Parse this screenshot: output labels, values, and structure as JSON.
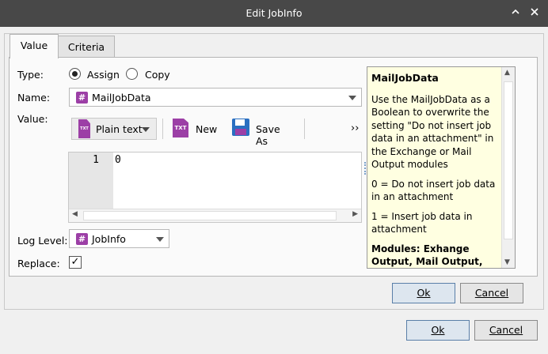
{
  "window": {
    "title": "Edit JobInfo",
    "expand_icon": "expand-icon",
    "close_icon": "close-icon"
  },
  "tabs": [
    {
      "label": "Value"
    },
    {
      "label": "Criteria"
    }
  ],
  "form": {
    "type_label": "Type:",
    "type_options": [
      {
        "label": "Assign",
        "selected": true
      },
      {
        "label": "Copy",
        "selected": false
      }
    ],
    "name_label": "Name:",
    "name_value": "MailJobData",
    "value_label": "Value:",
    "log_level_label": "Log Level:",
    "log_level_value": "JobInfo",
    "replace_label": "Replace:",
    "replace_checked": true,
    "replace_check_glyph": "✓"
  },
  "toolbar": {
    "format_label": "Plain text",
    "new_label": "New",
    "save_as_label": "Save As",
    "more_label": "››",
    "txt_icon_text": "TXT"
  },
  "editor": {
    "line_number": "1",
    "content": "0"
  },
  "help": {
    "title": "MailJobData",
    "paragraphs": [
      "Use the MailJobData as a Boolean to overwrite the setting \"Do not insert job data in an attachment\" in the Exchange or Mail Output modules",
      "0 = Do not insert job data in an attachment",
      "1 = Insert job data in attachment"
    ],
    "footer": "Modules: Exhange Output, Mail Output,"
  },
  "inner_buttons": {
    "ok": "Ok",
    "cancel": "Cancel"
  },
  "outer_buttons": {
    "ok": "Ok",
    "cancel": "Cancel"
  },
  "glyphs": {
    "hash": "#",
    "scroll_left": "◀",
    "scroll_right": "▶",
    "scroll_up": "▲",
    "scroll_down": "▼"
  }
}
